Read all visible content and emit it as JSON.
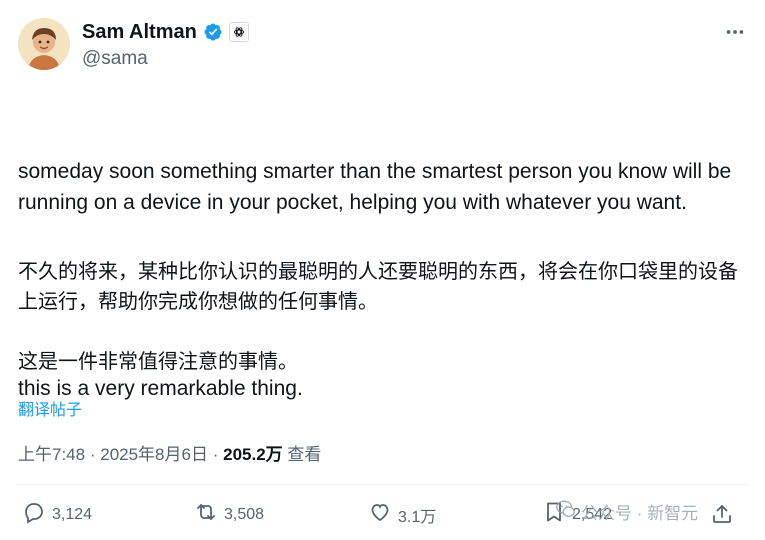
{
  "author": {
    "display_name": "Sam Altman",
    "handle": "@sama",
    "verified": true,
    "verified_color": "#1d9bf0"
  },
  "tweet": {
    "paragraphs": [
      "someday soon something smarter than the smartest person you know will be running on a device in your pocket, helping you with whatever you want.",
      "this is a very remarkable thing."
    ],
    "translated_paragraphs": [
      "不久的将来，某种比你认识的最聪明的人还要聪明的东西，将会在你口袋里的设备上运行，帮助你完成你想做的任何事情。",
      "这是一件非常值得注意的事情。"
    ],
    "translate_label": "翻译帖子"
  },
  "meta": {
    "time": "上午7:48",
    "separator": "·",
    "date": "2025年8月6日",
    "views_count": "205.2万",
    "views_label": "查看"
  },
  "actions": {
    "replies": "3,124",
    "reposts": "3,508",
    "likes": "3.1万",
    "bookmarks": "2,542"
  },
  "watermark": {
    "text": "公众号 · 新智元"
  },
  "icons": {
    "more": "more-horizontal-icon",
    "reply": "reply-icon",
    "repost": "repost-icon",
    "like": "heart-icon",
    "bookmark": "bookmark-icon",
    "share": "share-icon"
  },
  "colors": {
    "text": "#0f1419",
    "muted": "#536471",
    "link": "#1d9bf0"
  }
}
